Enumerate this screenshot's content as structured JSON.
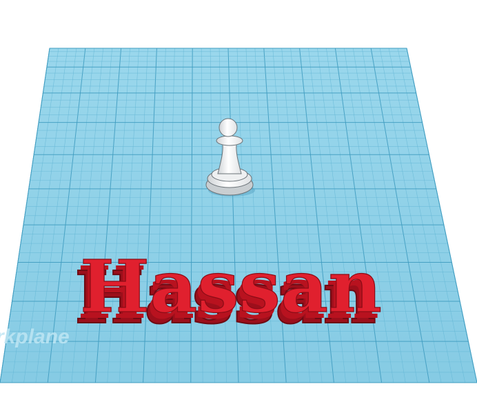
{
  "workplane": {
    "watermark": "rkplane",
    "grid_color": "#8ccfe6",
    "line_color": "#5fb4d3",
    "major_line_color": "#3f9cc0"
  },
  "text_object": {
    "text": "Hassan",
    "color": "#e0202e"
  },
  "pawn": {
    "color": "#ffffff",
    "name": "pawn"
  }
}
